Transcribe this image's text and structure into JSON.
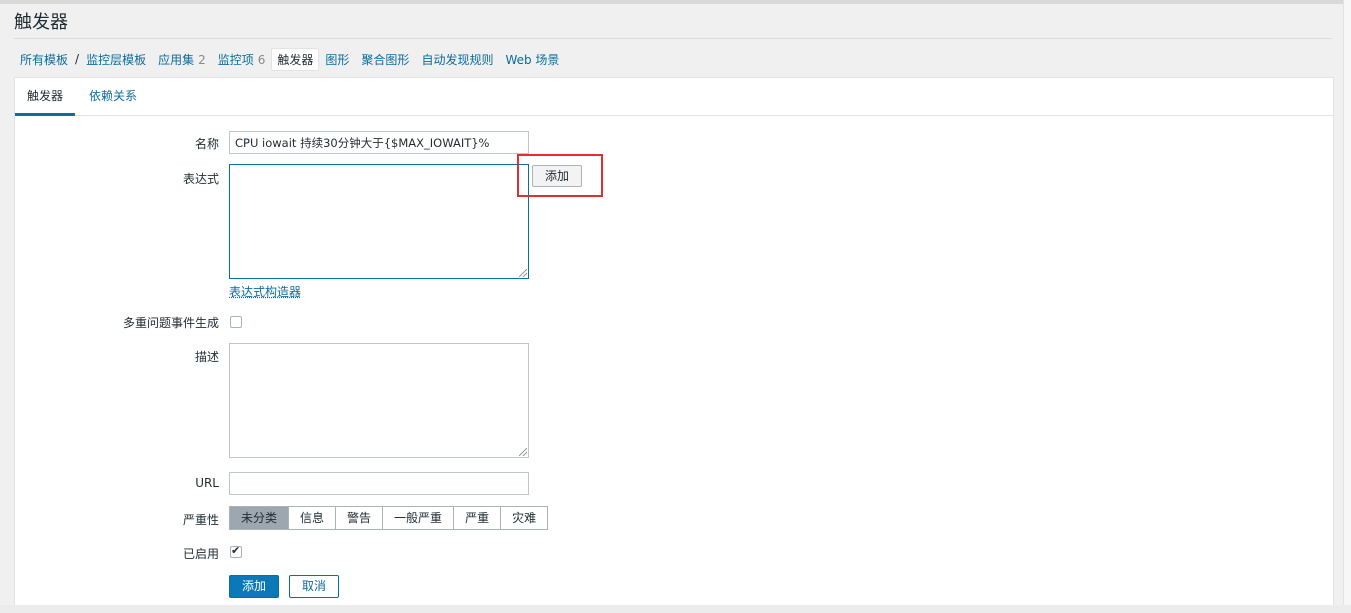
{
  "page": {
    "title": "触发器"
  },
  "breadcrumb": [
    {
      "label": "所有模板",
      "count": ""
    },
    {
      "label": "监控层模板",
      "count": ""
    },
    {
      "label": "应用集",
      "count": "2"
    },
    {
      "label": "监控项",
      "count": "6"
    },
    {
      "label": "触发器",
      "count": ""
    },
    {
      "label": "图形",
      "count": ""
    },
    {
      "label": "聚合图形",
      "count": ""
    },
    {
      "label": "自动发现规则",
      "count": ""
    },
    {
      "label": "Web 场景",
      "count": ""
    }
  ],
  "breadcrumb_separator": "/",
  "tabs": [
    {
      "label": "触发器"
    },
    {
      "label": "依赖关系"
    }
  ],
  "form": {
    "name_label": "名称",
    "name_value": "CPU iowait 持续30分钟大于{$MAX_IOWAIT}%",
    "expression_label": "表达式",
    "add_button": "添加",
    "expression_builder_link": "表达式构造器",
    "multiple_events_label": "多重问题事件生成",
    "multiple_events_checked": false,
    "description_label": "描述",
    "url_label": "URL",
    "url_value": "",
    "severity_label": "严重性",
    "severity_options": [
      "未分类",
      "信息",
      "警告",
      "一般严重",
      "严重",
      "灾难"
    ],
    "severity_selected": "未分类",
    "enabled_label": "已启用",
    "enabled_checked": true,
    "checkbox_tick": "✔",
    "submit_button": "添加",
    "cancel_button": "取消"
  },
  "colors": {
    "link": "#0b6c9e",
    "primary_button": "#0b78b8",
    "highlight": "#e02f33",
    "severity_selected": "#9ca7b0"
  }
}
